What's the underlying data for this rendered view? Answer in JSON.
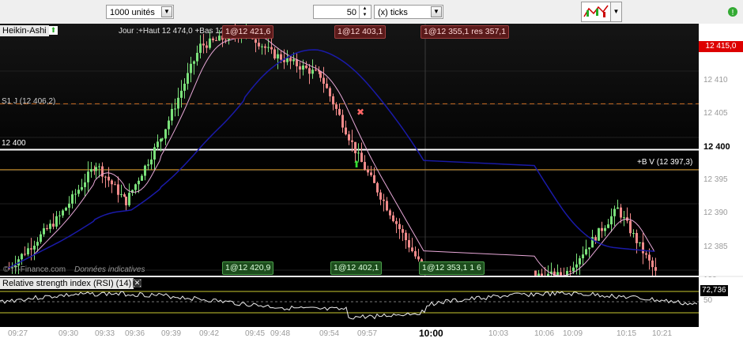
{
  "toolbar": {
    "units_select": "1000 unités",
    "ticks_value": "50",
    "ticks_select": "(x) ticks"
  },
  "chart": {
    "name": "Heikin-Ashi",
    "info": "Jour :+Haut 12 474,0 +Bas 12 300,0",
    "watermark": "© IT-Finance.com",
    "disclaimer": "Données indicatives",
    "s1_label": "S1 J (12 406,2)",
    "level_label": "12 400",
    "bv_label": "+B V (12 397,3)",
    "price_badge": "12 415,0",
    "price_badge_color": "#cc0000",
    "orders_top": [
      "1@12 421,6",
      "1@12 403,1",
      "1@12 355,1 res 357,1"
    ],
    "orders_bottom": [
      "1@12 420,9",
      "1@12 402,1",
      "1@12 353,1 1 6"
    ],
    "y_ticks": [
      "12 410",
      "12 405",
      "12 400",
      "12 395",
      "12 390",
      "12 385",
      "100"
    ],
    "ma_fast_color": "#e8a8d8",
    "ma_slow_color": "#1a1aa8",
    "bull_color": "#7ae07a",
    "bear_color": "#f08a8a"
  },
  "rsi": {
    "title": "Relative strength index (RSI) (14)",
    "value": "72,736",
    "y_ticks": [
      "50"
    ]
  },
  "x_ticks": [
    "09:27",
    "09:30",
    "09:33",
    "09:36",
    "09:39",
    "09:42",
    "09:45",
    "09:48",
    "09:54",
    "09:57",
    "10:00",
    "10:03",
    "10:06",
    "10:09",
    "10:15",
    "10:21"
  ],
  "chart_data": {
    "type": "candlestick",
    "x": [
      "09:27",
      "09:30",
      "09:33",
      "09:36",
      "09:39",
      "09:42",
      "09:45",
      "09:48",
      "09:54",
      "09:57",
      "10:00",
      "10:03",
      "10:06",
      "10:09",
      "10:15",
      "10:21"
    ],
    "ylim": [
      12383,
      12417
    ],
    "levels": [
      {
        "name": "S1 J",
        "value": 12406.2
      },
      {
        "name": "12 400",
        "value": 12400
      },
      {
        "name": "+B V",
        "value": 12397.3
      }
    ],
    "series": [
      {
        "name": "Heikin-Ashi",
        "close": [
          12384,
          12391,
          12398,
          12393,
          12402,
          12414,
          12416,
          12413,
          12410,
          12399,
          12383,
          null,
          12383,
          12383,
          12392,
          12383
        ]
      }
    ]
  }
}
